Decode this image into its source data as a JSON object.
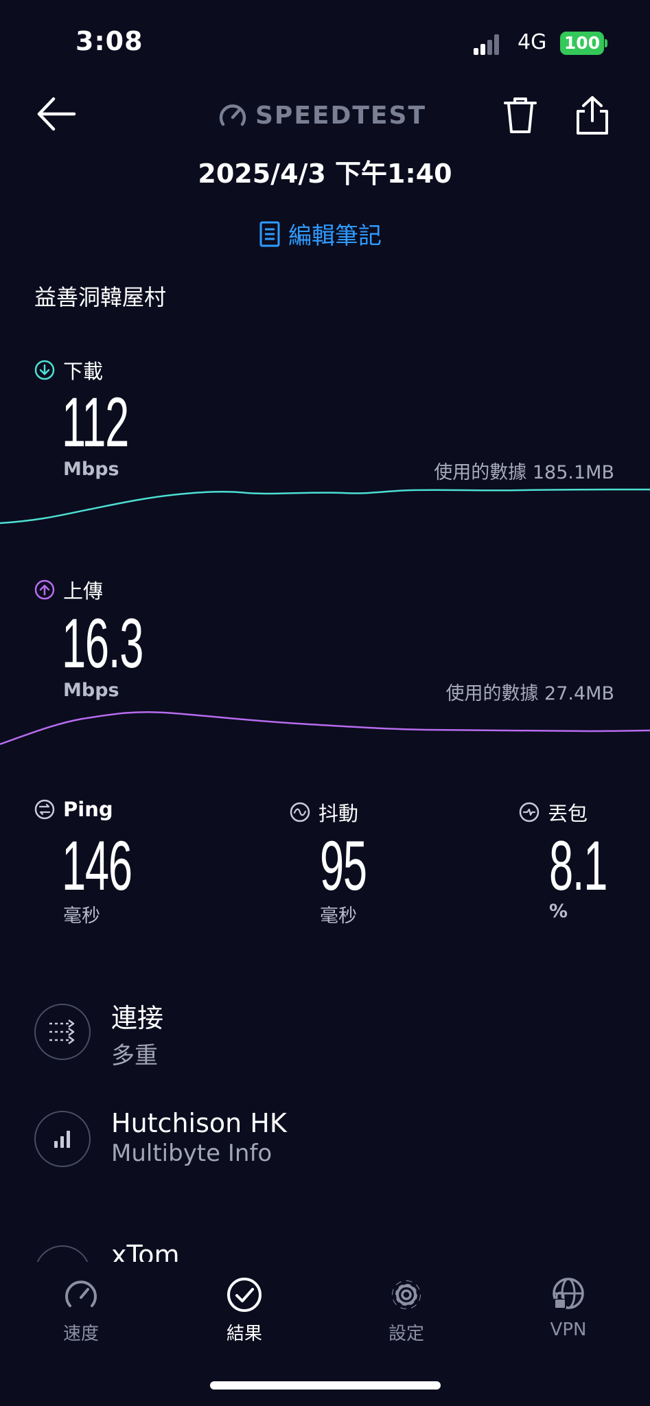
{
  "status_bar": {
    "time": "3:08",
    "network": "4G",
    "battery": "100"
  },
  "header": {
    "logo_text": "SPEEDTEST",
    "date": "2025/4/3 下午1:40",
    "notes_label": "編輯筆記"
  },
  "location": "益善洞韓屋村",
  "download": {
    "label": "下載",
    "value": "112",
    "unit": "Mbps",
    "data_used": "使用的數據 185.1MB",
    "color": "#4ce0d2"
  },
  "upload": {
    "label": "上傳",
    "value": "16.3",
    "unit": "Mbps",
    "data_used": "使用的數據 27.4MB",
    "color": "#b86cf0"
  },
  "ping": {
    "label": "Ping",
    "value": "146",
    "unit": "毫秒"
  },
  "jitter": {
    "label": "抖動",
    "value": "95",
    "unit": "毫秒"
  },
  "packet_loss": {
    "label": "丟包",
    "value": "8.1",
    "unit": "%"
  },
  "connection": {
    "title": "連接",
    "subtitle": "多重"
  },
  "isp": {
    "title": "Hutchison HK",
    "subtitle": "Multibyte Info"
  },
  "server": {
    "title": "xTom"
  },
  "tabs": [
    {
      "label": "速度",
      "icon": "speed-icon",
      "active": false
    },
    {
      "label": "結果",
      "icon": "results-check-icon",
      "active": true
    },
    {
      "label": "設定",
      "icon": "gear-icon",
      "active": false
    },
    {
      "label": "VPN",
      "icon": "vpn-globe-icon",
      "active": false
    }
  ],
  "colors": {
    "background": "#0b0c1e",
    "accent_blue": "#2f9bff",
    "battery_green": "#34c759"
  }
}
